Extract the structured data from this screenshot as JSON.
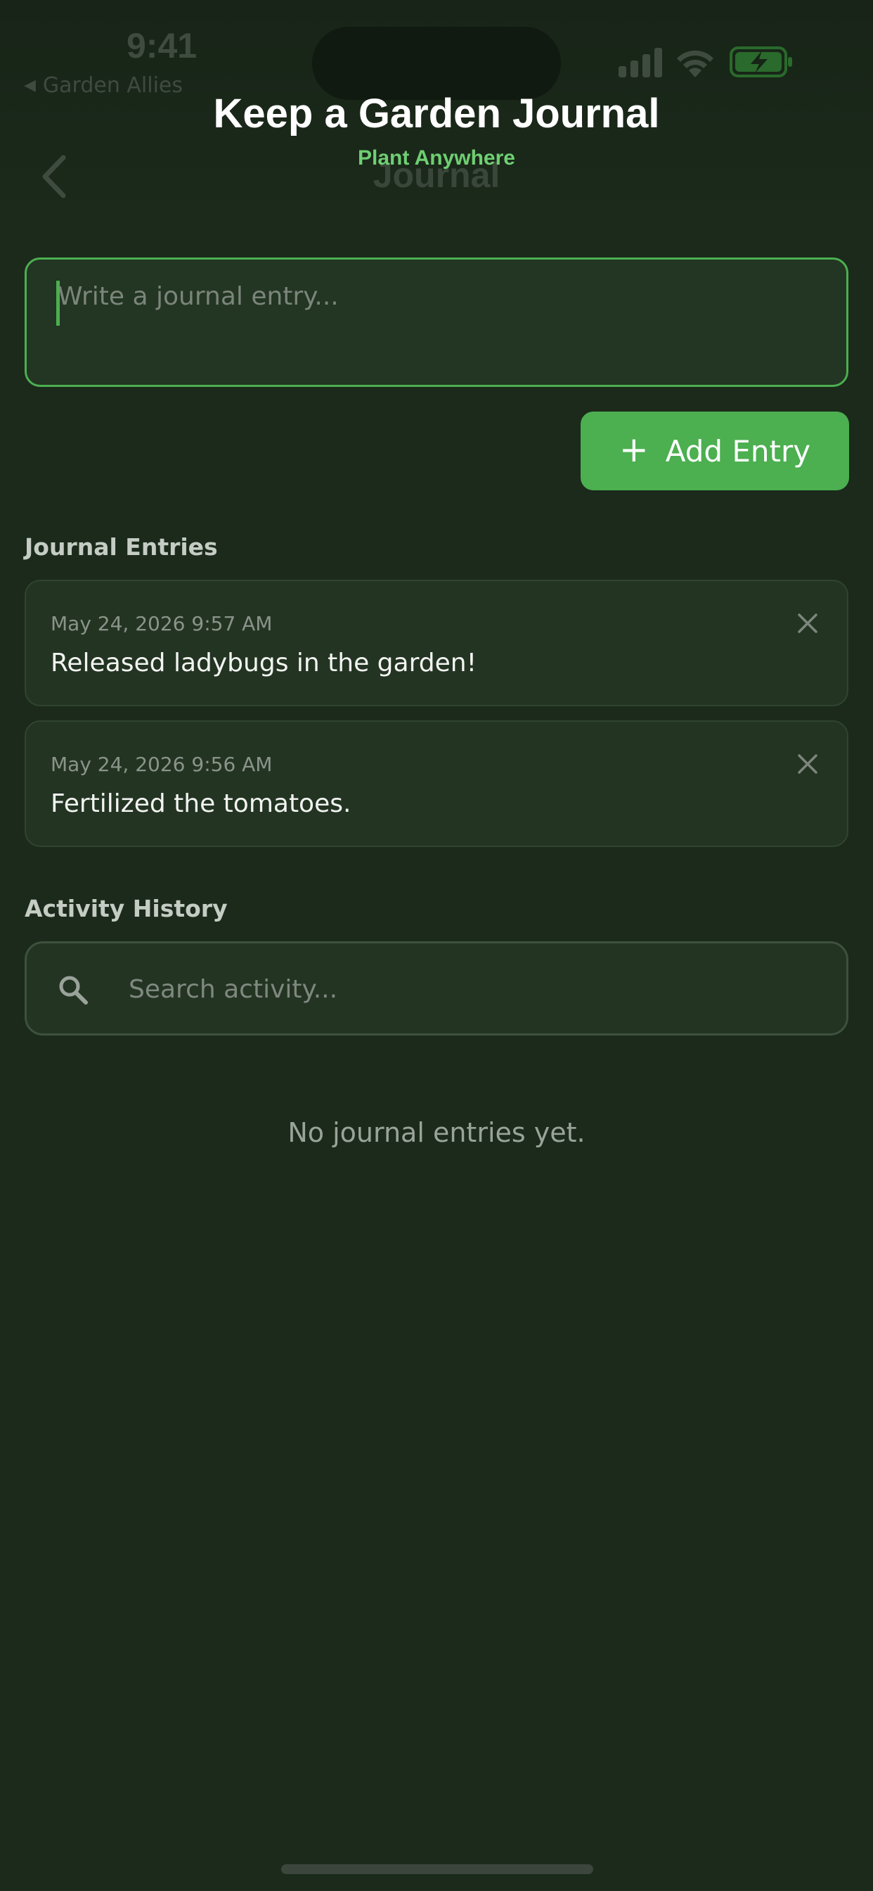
{
  "status_bar": {
    "time": "9:41",
    "back_app": "Garden Allies",
    "back_triangle": "◀"
  },
  "nav": {
    "title": "Journal",
    "back_icon": "chevron-left-icon"
  },
  "banner": {
    "title": "Keep a Garden Journal",
    "subtitle": "Plant Anywhere"
  },
  "composer": {
    "placeholder": "Write a journal entry...",
    "value": "",
    "add_label": "Add Entry",
    "add_icon": "+"
  },
  "journal": {
    "heading": "Journal Entries",
    "entries": [
      {
        "date": "May 24, 2026 9:57 AM",
        "text": "Released ladybugs in the garden!"
      },
      {
        "date": "May 24, 2026 9:56 AM",
        "text": "Fertilized the tomatoes."
      }
    ]
  },
  "activity": {
    "heading": "Activity History",
    "search_placeholder": "Search activity...",
    "empty_message": "No journal entries yet."
  },
  "colors": {
    "background": "#1b2a1b",
    "accent": "#4caf50",
    "subtitle": "#6fcf72"
  }
}
